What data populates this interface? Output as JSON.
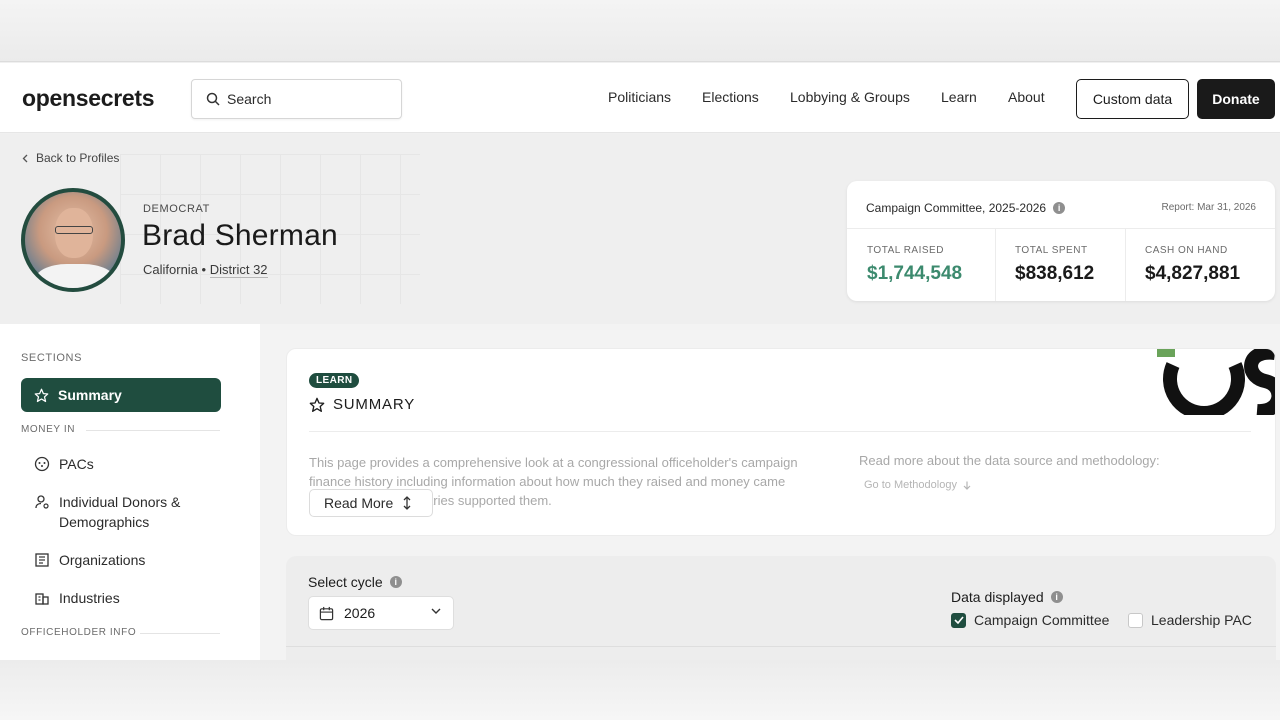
{
  "header": {
    "logo_part1": "open",
    "logo_part2": "secrets",
    "search_placeholder": "Search",
    "nav": [
      "Politicians",
      "Elections",
      "Lobbying & Groups",
      "Learn",
      "About"
    ],
    "custom_data_label": "Custom data",
    "donate_label": "Donate"
  },
  "profile": {
    "back_label": "Back to Profiles",
    "party": "DEMOCRAT",
    "name": "Brad Sherman",
    "state": "California",
    "separator": "•",
    "district": "District 32"
  },
  "finance_card": {
    "title": "Campaign Committee, 2025-2026",
    "report": "Report: Mar 31, 2026",
    "stats": [
      {
        "label": "TOTAL RAISED",
        "value": "$1,744,548"
      },
      {
        "label": "TOTAL SPENT",
        "value": "$838,612"
      },
      {
        "label": "CASH ON HAND",
        "value": "$4,827,881"
      }
    ]
  },
  "sidebar": {
    "sections_label": "SECTIONS",
    "active_label": "Summary",
    "money_in_label": "MONEY IN",
    "items": [
      "PACs",
      "Individual Donors & Demographics",
      "Organizations",
      "Industries"
    ],
    "officeholder_label": "OFFICEHOLDER INFO"
  },
  "summary": {
    "pill": "LEARN",
    "title": "SUMMARY",
    "description": "This page provides a comprehensive look at a congressional officeholder's campaign finance history including information about how much they raised and money came from, and what industries supported them.",
    "read_more": "Read More",
    "method_text": "Read more about the data source and methodology:",
    "goto_method": "Go to Methodology"
  },
  "cycle": {
    "label": "Select cycle",
    "selected": "2026",
    "data_displayed_label": "Data displayed",
    "options": [
      {
        "label": "Campaign Committee",
        "checked": true
      },
      {
        "label": "Leadership PAC",
        "checked": false
      }
    ]
  },
  "colors": {
    "brand_green": "#1f4d3f",
    "raised_green": "#3c8a6e"
  }
}
